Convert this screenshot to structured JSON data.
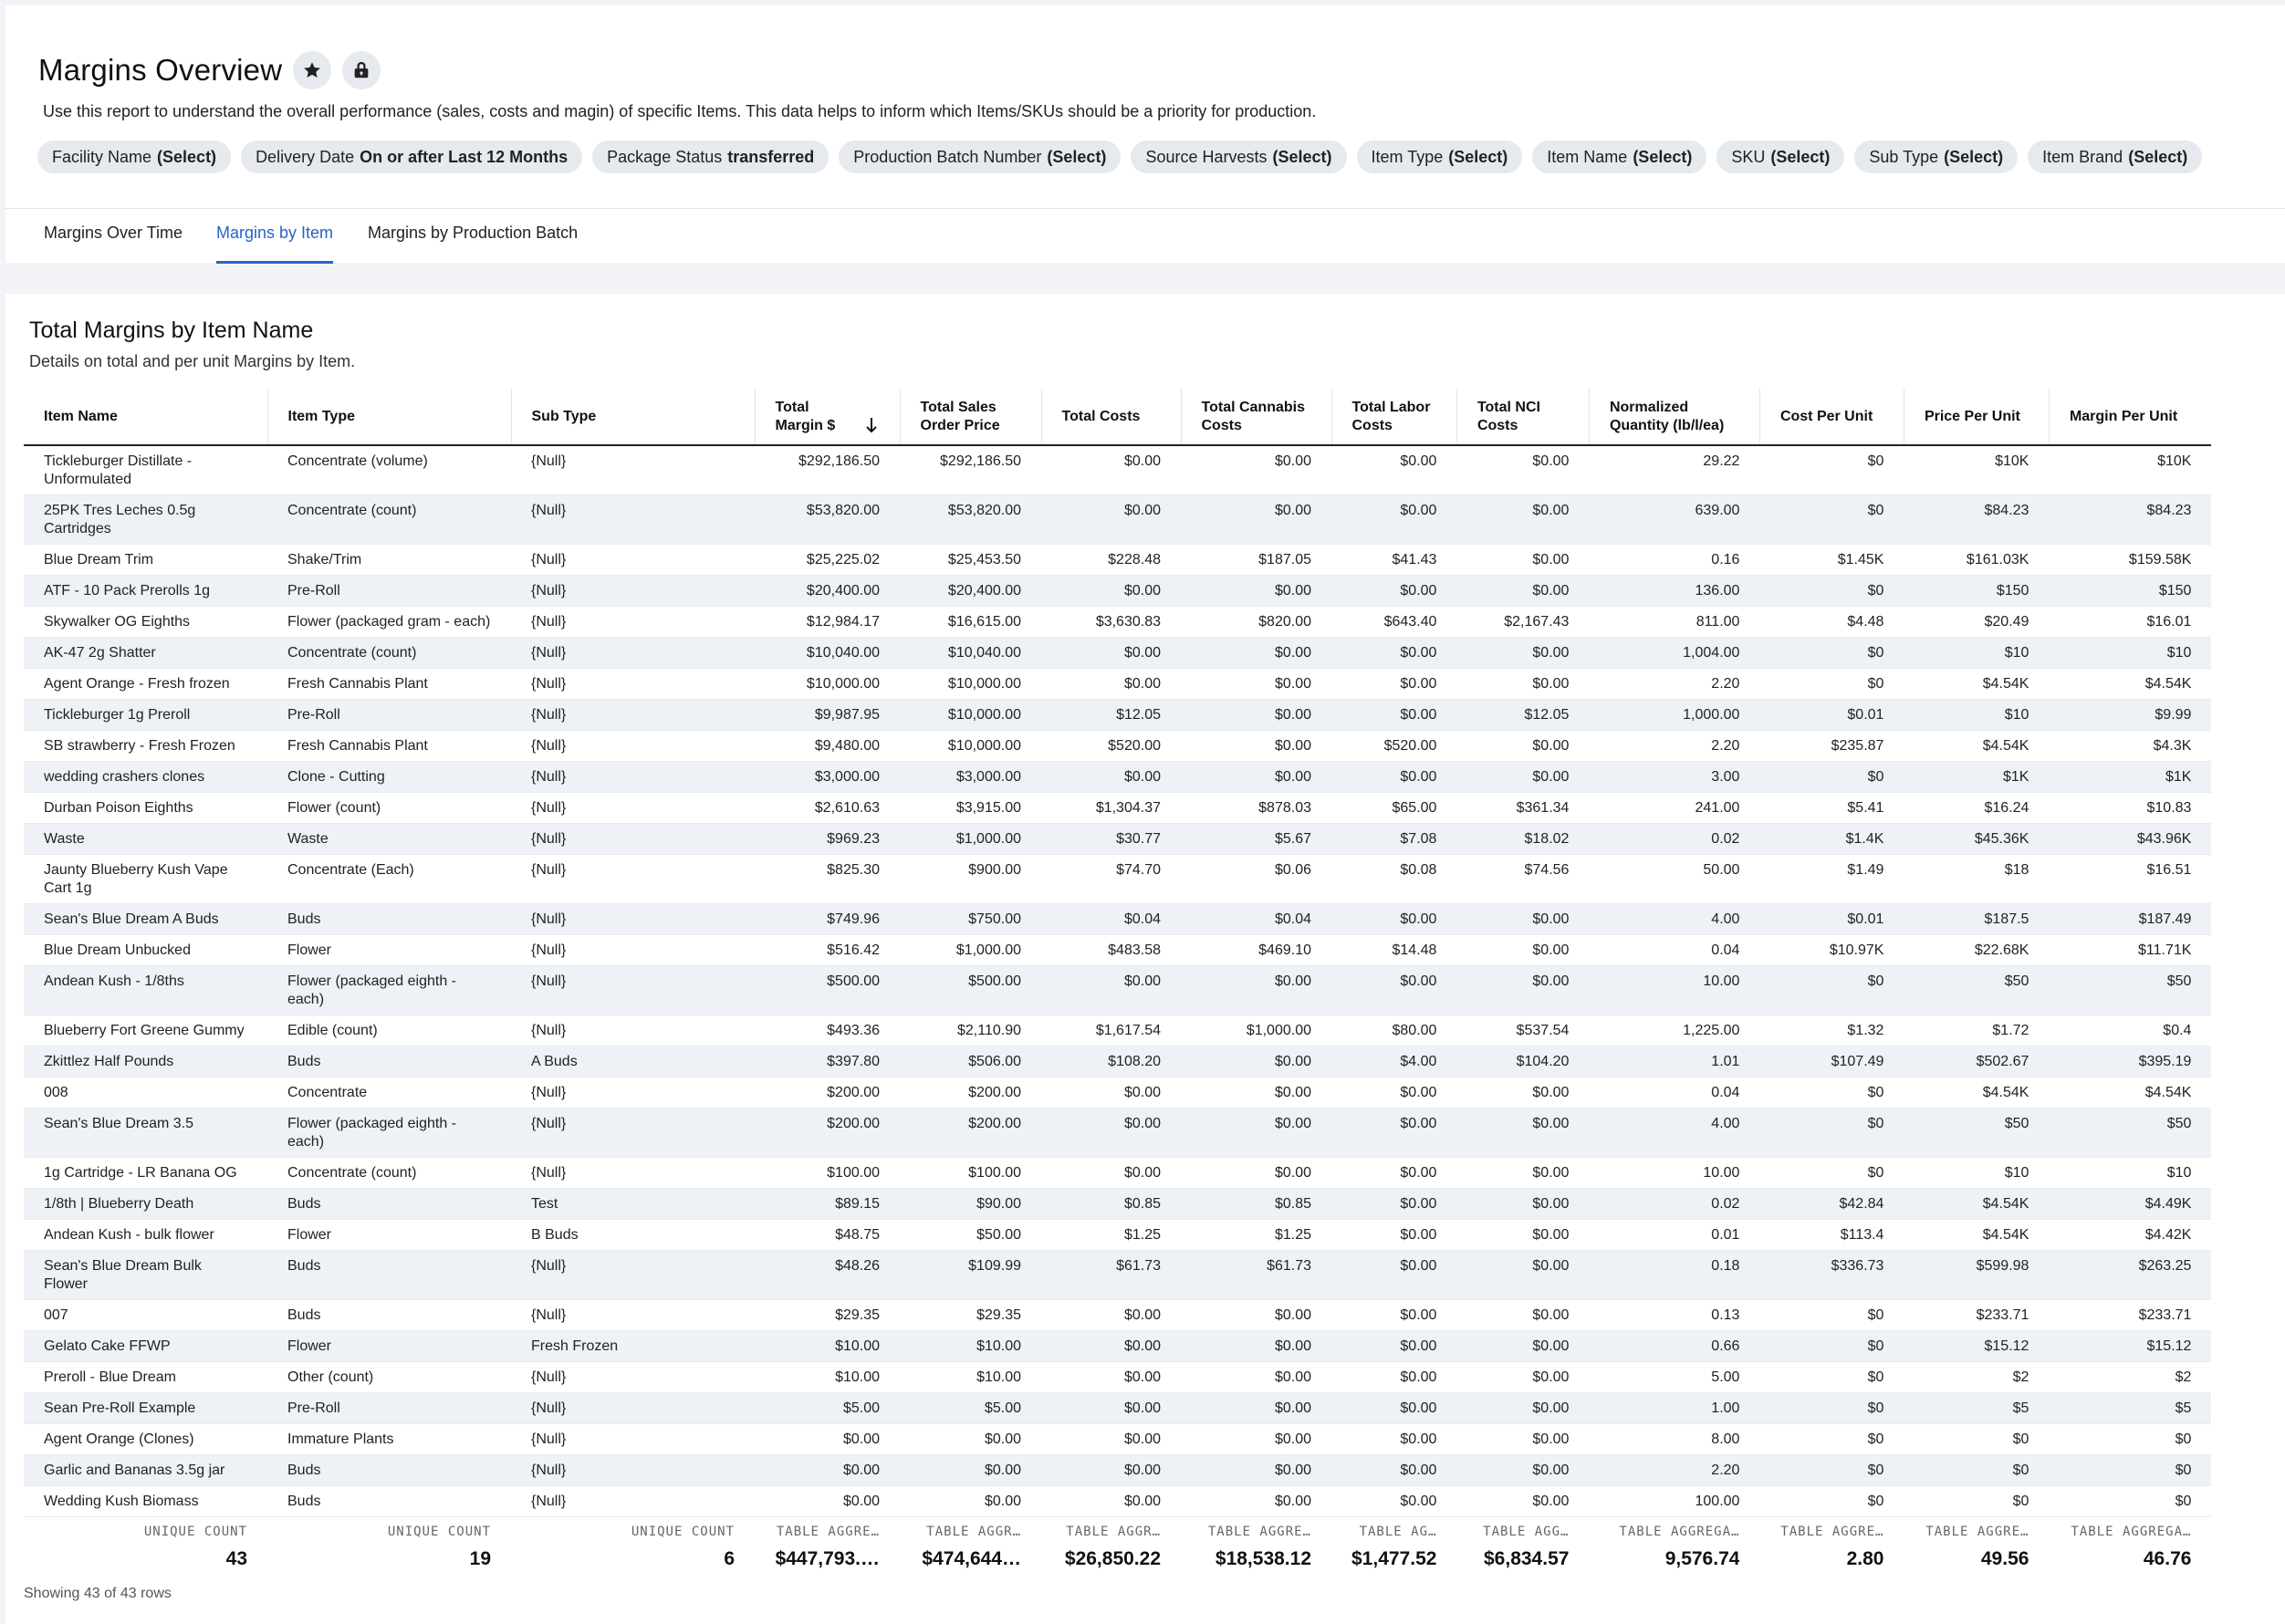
{
  "header": {
    "title": "Margins Overview",
    "description": "Use this report to understand the overall performance (sales, costs and magin) of specific Items. This data helps to inform which Items/SKUs should be a priority for production."
  },
  "filters": [
    {
      "label": "Facility Name",
      "value": "(Select)"
    },
    {
      "label": "Delivery Date",
      "value": "On or after Last 12 Months"
    },
    {
      "label": "Package Status",
      "value": "transferred"
    },
    {
      "label": "Production Batch Number",
      "value": "(Select)"
    },
    {
      "label": "Source Harvests",
      "value": "(Select)"
    },
    {
      "label": "Item Type",
      "value": "(Select)"
    },
    {
      "label": "Item Name",
      "value": "(Select)"
    },
    {
      "label": "SKU",
      "value": "(Select)"
    },
    {
      "label": "Sub Type",
      "value": "(Select)"
    },
    {
      "label": "Item Brand",
      "value": "(Select)"
    }
  ],
  "tabs": [
    {
      "label": "Margins Over Time"
    },
    {
      "label": "Margins by Item"
    },
    {
      "label": "Margins by Production Batch"
    }
  ],
  "section": {
    "title": "Total Margins by Item Name",
    "subtitle": "Details on total and per unit Margins by Item."
  },
  "columns": [
    "Item Name",
    "Item Type",
    "Sub Type",
    "Total Margin $",
    "Total Sales Order Price",
    "Total Costs",
    "Total Cannabis Costs",
    "Total Labor Costs",
    "Total NCI Costs",
    "Normalized Quantity (lb/l/ea)",
    "Cost Per Unit",
    "Price Per Unit",
    "Margin Per Unit"
  ],
  "rows": [
    [
      "Tickleburger Distillate - Unformulated",
      "Concentrate (volume)",
      "{Null}",
      "$292,186.50",
      "$292,186.50",
      "$0.00",
      "$0.00",
      "$0.00",
      "$0.00",
      "29.22",
      "$0",
      "$10K",
      "$10K"
    ],
    [
      "25PK Tres Leches 0.5g Cartridges",
      "Concentrate (count)",
      "{Null}",
      "$53,820.00",
      "$53,820.00",
      "$0.00",
      "$0.00",
      "$0.00",
      "$0.00",
      "639.00",
      "$0",
      "$84.23",
      "$84.23"
    ],
    [
      "Blue Dream Trim",
      "Shake/Trim",
      "{Null}",
      "$25,225.02",
      "$25,453.50",
      "$228.48",
      "$187.05",
      "$41.43",
      "$0.00",
      "0.16",
      "$1.45K",
      "$161.03K",
      "$159.58K"
    ],
    [
      "ATF - 10 Pack Prerolls 1g",
      "Pre-Roll",
      "{Null}",
      "$20,400.00",
      "$20,400.00",
      "$0.00",
      "$0.00",
      "$0.00",
      "$0.00",
      "136.00",
      "$0",
      "$150",
      "$150"
    ],
    [
      "Skywalker OG Eighths",
      "Flower (packaged gram - each)",
      "{Null}",
      "$12,984.17",
      "$16,615.00",
      "$3,630.83",
      "$820.00",
      "$643.40",
      "$2,167.43",
      "811.00",
      "$4.48",
      "$20.49",
      "$16.01"
    ],
    [
      "AK-47 2g Shatter",
      "Concentrate (count)",
      "{Null}",
      "$10,040.00",
      "$10,040.00",
      "$0.00",
      "$0.00",
      "$0.00",
      "$0.00",
      "1,004.00",
      "$0",
      "$10",
      "$10"
    ],
    [
      "Agent Orange - Fresh frozen",
      "Fresh Cannabis Plant",
      "{Null}",
      "$10,000.00",
      "$10,000.00",
      "$0.00",
      "$0.00",
      "$0.00",
      "$0.00",
      "2.20",
      "$0",
      "$4.54K",
      "$4.54K"
    ],
    [
      "Tickleburger 1g Preroll",
      "Pre-Roll",
      "{Null}",
      "$9,987.95",
      "$10,000.00",
      "$12.05",
      "$0.00",
      "$0.00",
      "$12.05",
      "1,000.00",
      "$0.01",
      "$10",
      "$9.99"
    ],
    [
      "SB strawberry - Fresh Frozen",
      "Fresh Cannabis Plant",
      "{Null}",
      "$9,480.00",
      "$10,000.00",
      "$520.00",
      "$0.00",
      "$520.00",
      "$0.00",
      "2.20",
      "$235.87",
      "$4.54K",
      "$4.3K"
    ],
    [
      "wedding crashers clones",
      "Clone - Cutting",
      "{Null}",
      "$3,000.00",
      "$3,000.00",
      "$0.00",
      "$0.00",
      "$0.00",
      "$0.00",
      "3.00",
      "$0",
      "$1K",
      "$1K"
    ],
    [
      "Durban Poison Eighths",
      "Flower (count)",
      "{Null}",
      "$2,610.63",
      "$3,915.00",
      "$1,304.37",
      "$878.03",
      "$65.00",
      "$361.34",
      "241.00",
      "$5.41",
      "$16.24",
      "$10.83"
    ],
    [
      "Waste",
      "Waste",
      "{Null}",
      "$969.23",
      "$1,000.00",
      "$30.77",
      "$5.67",
      "$7.08",
      "$18.02",
      "0.02",
      "$1.4K",
      "$45.36K",
      "$43.96K"
    ],
    [
      "Jaunty Blueberry Kush Vape Cart 1g",
      "Concentrate (Each)",
      "{Null}",
      "$825.30",
      "$900.00",
      "$74.70",
      "$0.06",
      "$0.08",
      "$74.56",
      "50.00",
      "$1.49",
      "$18",
      "$16.51"
    ],
    [
      "Sean's Blue Dream A Buds",
      "Buds",
      "{Null}",
      "$749.96",
      "$750.00",
      "$0.04",
      "$0.04",
      "$0.00",
      "$0.00",
      "4.00",
      "$0.01",
      "$187.5",
      "$187.49"
    ],
    [
      "Blue Dream Unbucked",
      "Flower",
      "{Null}",
      "$516.42",
      "$1,000.00",
      "$483.58",
      "$469.10",
      "$14.48",
      "$0.00",
      "0.04",
      "$10.97K",
      "$22.68K",
      "$11.71K"
    ],
    [
      "Andean Kush - 1/8ths",
      "Flower (packaged eighth - each)",
      "{Null}",
      "$500.00",
      "$500.00",
      "$0.00",
      "$0.00",
      "$0.00",
      "$0.00",
      "10.00",
      "$0",
      "$50",
      "$50"
    ],
    [
      "Blueberry Fort Greene Gummy",
      "Edible (count)",
      "{Null}",
      "$493.36",
      "$2,110.90",
      "$1,617.54",
      "$1,000.00",
      "$80.00",
      "$537.54",
      "1,225.00",
      "$1.32",
      "$1.72",
      "$0.4"
    ],
    [
      "Zkittlez Half Pounds",
      "Buds",
      "A Buds",
      "$397.80",
      "$506.00",
      "$108.20",
      "$0.00",
      "$4.00",
      "$104.20",
      "1.01",
      "$107.49",
      "$502.67",
      "$395.19"
    ],
    [
      "008",
      "Concentrate",
      "{Null}",
      "$200.00",
      "$200.00",
      "$0.00",
      "$0.00",
      "$0.00",
      "$0.00",
      "0.04",
      "$0",
      "$4.54K",
      "$4.54K"
    ],
    [
      "Sean's Blue Dream 3.5",
      "Flower (packaged eighth - each)",
      "{Null}",
      "$200.00",
      "$200.00",
      "$0.00",
      "$0.00",
      "$0.00",
      "$0.00",
      "4.00",
      "$0",
      "$50",
      "$50"
    ],
    [
      "1g Cartridge - LR Banana OG",
      "Concentrate (count)",
      "{Null}",
      "$100.00",
      "$100.00",
      "$0.00",
      "$0.00",
      "$0.00",
      "$0.00",
      "10.00",
      "$0",
      "$10",
      "$10"
    ],
    [
      "1/8th | Blueberry Death",
      "Buds",
      "Test",
      "$89.15",
      "$90.00",
      "$0.85",
      "$0.85",
      "$0.00",
      "$0.00",
      "0.02",
      "$42.84",
      "$4.54K",
      "$4.49K"
    ],
    [
      "Andean Kush - bulk flower",
      "Flower",
      "B Buds",
      "$48.75",
      "$50.00",
      "$1.25",
      "$1.25",
      "$0.00",
      "$0.00",
      "0.01",
      "$113.4",
      "$4.54K",
      "$4.42K"
    ],
    [
      "Sean's Blue Dream Bulk Flower",
      "Buds",
      "{Null}",
      "$48.26",
      "$109.99",
      "$61.73",
      "$61.73",
      "$0.00",
      "$0.00",
      "0.18",
      "$336.73",
      "$599.98",
      "$263.25"
    ],
    [
      "007",
      "Buds",
      "{Null}",
      "$29.35",
      "$29.35",
      "$0.00",
      "$0.00",
      "$0.00",
      "$0.00",
      "0.13",
      "$0",
      "$233.71",
      "$233.71"
    ],
    [
      "Gelato Cake FFWP",
      "Flower",
      "Fresh Frozen",
      "$10.00",
      "$10.00",
      "$0.00",
      "$0.00",
      "$0.00",
      "$0.00",
      "0.66",
      "$0",
      "$15.12",
      "$15.12"
    ],
    [
      "Preroll - Blue Dream",
      "Other (count)",
      "{Null}",
      "$10.00",
      "$10.00",
      "$0.00",
      "$0.00",
      "$0.00",
      "$0.00",
      "5.00",
      "$0",
      "$2",
      "$2"
    ],
    [
      "Sean Pre-Roll Example",
      "Pre-Roll",
      "{Null}",
      "$5.00",
      "$5.00",
      "$0.00",
      "$0.00",
      "$0.00",
      "$0.00",
      "1.00",
      "$0",
      "$5",
      "$5"
    ],
    [
      "Agent Orange (Clones)",
      "Immature Plants",
      "{Null}",
      "$0.00",
      "$0.00",
      "$0.00",
      "$0.00",
      "$0.00",
      "$0.00",
      "8.00",
      "$0",
      "$0",
      "$0"
    ],
    [
      "Garlic and Bananas 3.5g jar",
      "Buds",
      "{Null}",
      "$0.00",
      "$0.00",
      "$0.00",
      "$0.00",
      "$0.00",
      "$0.00",
      "2.20",
      "$0",
      "$0",
      "$0"
    ],
    [
      "Wedding Kush Biomass",
      "Buds",
      "{Null}",
      "$0.00",
      "$0.00",
      "$0.00",
      "$0.00",
      "$0.00",
      "$0.00",
      "100.00",
      "$0",
      "$0",
      "$0"
    ]
  ],
  "aggregates": [
    {
      "label": "UNIQUE COUNT",
      "value": "43"
    },
    {
      "label": "UNIQUE COUNT",
      "value": "19"
    },
    {
      "label": "UNIQUE COUNT",
      "value": "6"
    },
    {
      "label": "TABLE AGGRE…",
      "value": "$447,793.…"
    },
    {
      "label": "TABLE AGGR…",
      "value": "$474,644…"
    },
    {
      "label": "TABLE AGGR…",
      "value": "$26,850.22"
    },
    {
      "label": "TABLE AGGRE…",
      "value": "$18,538.12"
    },
    {
      "label": "TABLE AG…",
      "value": "$1,477.52"
    },
    {
      "label": "TABLE AGG…",
      "value": "$6,834.57"
    },
    {
      "label": "TABLE AGGREGA…",
      "value": "9,576.74"
    },
    {
      "label": "TABLE AGGRE…",
      "value": "2.80"
    },
    {
      "label": "TABLE AGGRE…",
      "value": "49.56"
    },
    {
      "label": "TABLE AGGREGA…",
      "value": "46.76"
    }
  ],
  "showing": "Showing 43 of 43 rows"
}
